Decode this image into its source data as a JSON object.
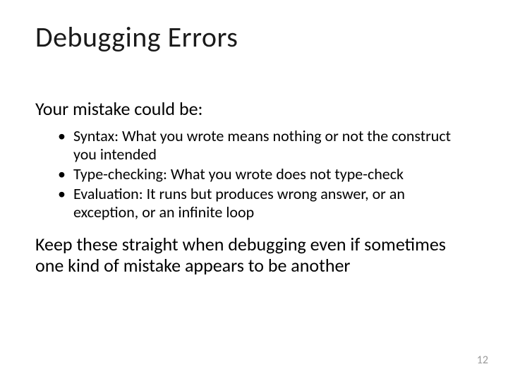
{
  "slide": {
    "title": "Debugging Errors",
    "lead": "Your mistake could be:",
    "bullets": [
      "Syntax: What you wrote means nothing or not the construct you intended",
      "Type-checking: What you wrote does not type-check",
      "Evaluation: It runs but produces wrong answer, or an exception, or an infinite loop"
    ],
    "closing": "Keep these straight when debugging even if sometimes one kind of mistake appears to be another",
    "page_number": "12"
  }
}
